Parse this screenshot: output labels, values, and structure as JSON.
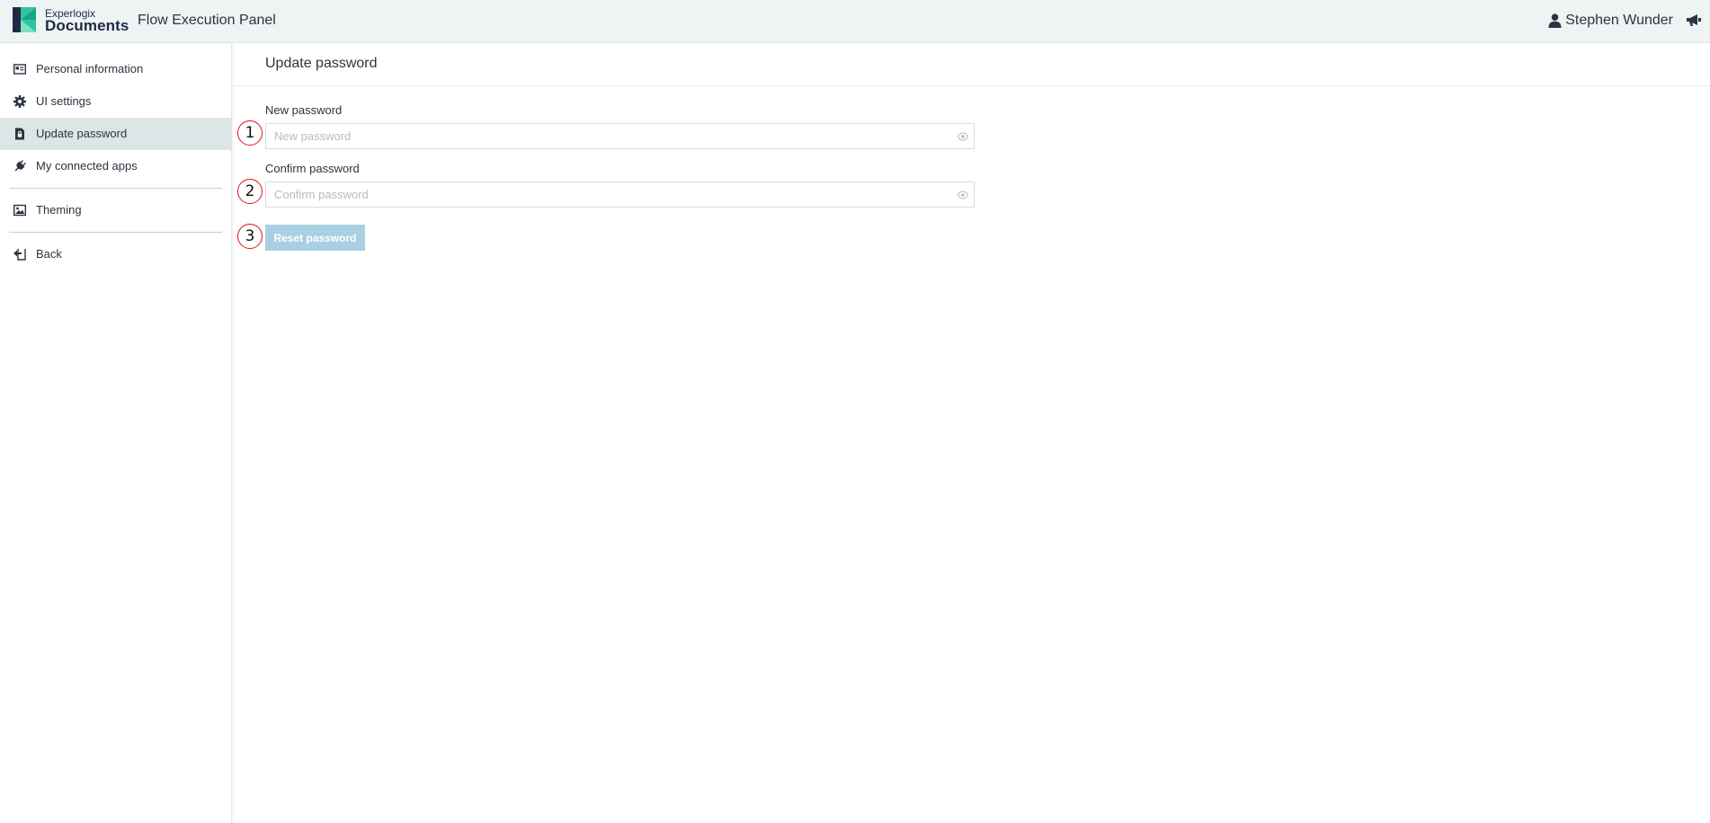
{
  "header": {
    "brand_top": "Experlogix",
    "brand_main": "Documents",
    "app_title": "Flow Execution Panel",
    "user_name": "Stephen Wunder",
    "icons": {
      "logo": "experlogix-logo",
      "user": "user-icon",
      "announce": "megaphone-icon"
    }
  },
  "sidebar": {
    "items": [
      {
        "label": "Personal information",
        "icon": "id-card-icon",
        "active": false
      },
      {
        "label": "UI settings",
        "icon": "gear-icon",
        "active": false
      },
      {
        "label": "Update password",
        "icon": "lock-document-icon",
        "active": true
      },
      {
        "label": "My connected apps",
        "icon": "plug-icon",
        "active": false
      },
      {
        "label": "Theming",
        "icon": "image-icon",
        "active": false
      },
      {
        "label": "Back",
        "icon": "back-arrow-icon",
        "active": false
      }
    ]
  },
  "main": {
    "title": "Update password",
    "fields": [
      {
        "label": "New password",
        "placeholder": "New password",
        "value": ""
      },
      {
        "label": "Confirm password",
        "placeholder": "Confirm password",
        "value": ""
      }
    ],
    "reset_button": "Reset password",
    "markers": [
      "1",
      "2",
      "3"
    ]
  },
  "colors": {
    "header_bg": "#eef3f3",
    "active_nav_bg": "#dde6e6",
    "button_bg": "#a9cfe3",
    "marker_border": "#e0141a",
    "logo_green": "#2ec4a0",
    "logo_dark": "#1f2a44"
  }
}
